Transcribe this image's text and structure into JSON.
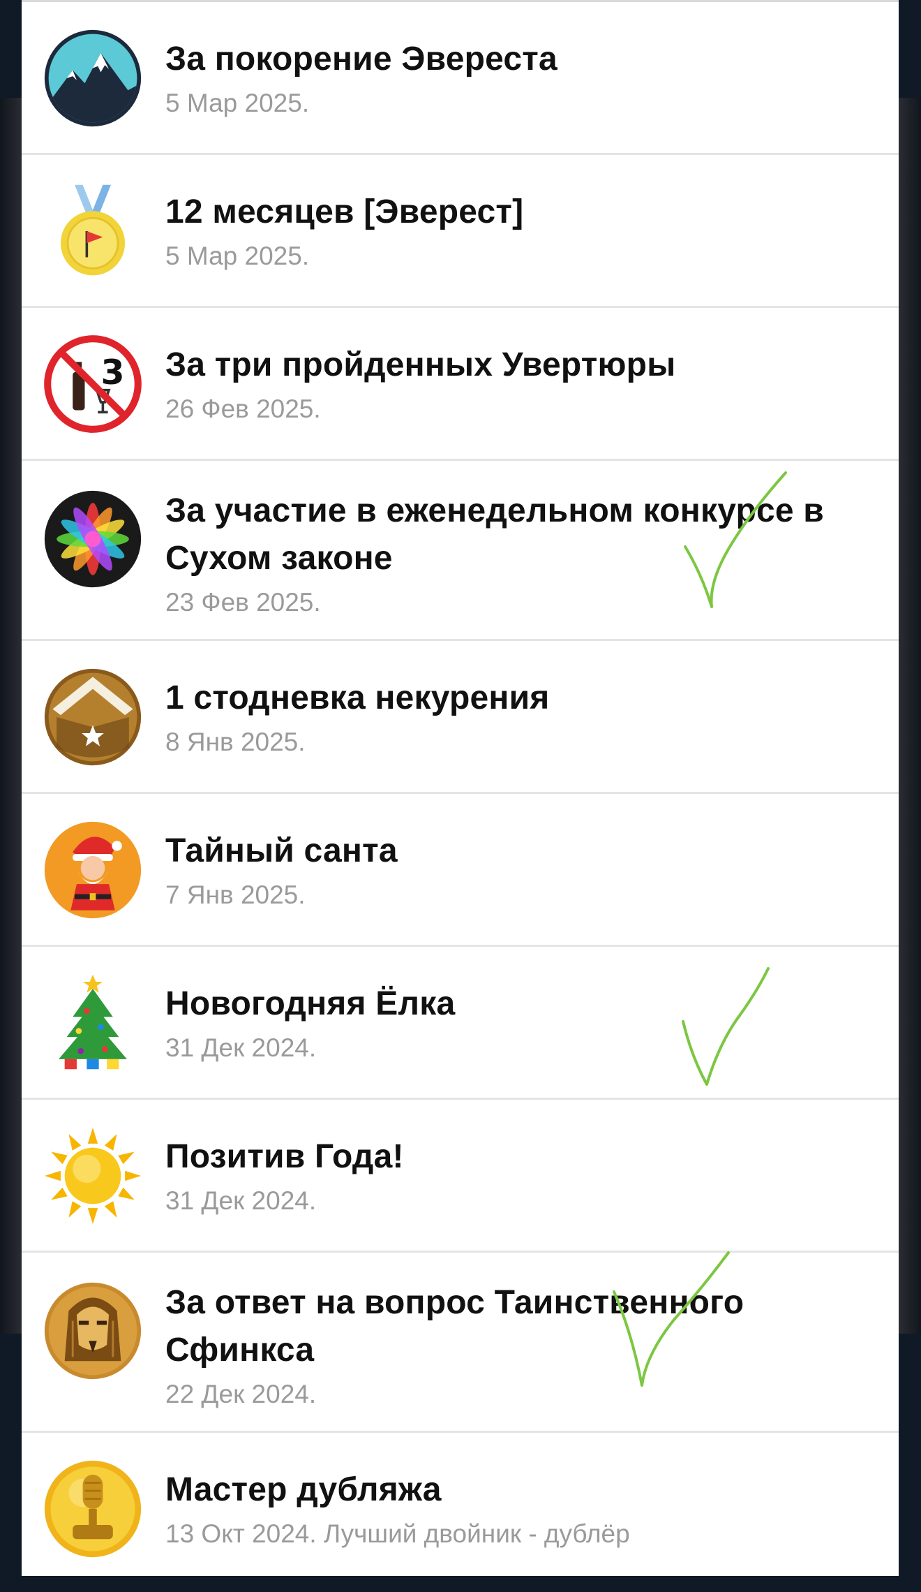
{
  "awards": [
    {
      "title": "За покорение Эвереста",
      "date": "5 Мар 2025.",
      "icon": "mountain-icon"
    },
    {
      "title": "12 месяцев [Эверест]",
      "date": "5 Мар 2025.",
      "icon": "medal-icon"
    },
    {
      "title": "За три пройденных Увертюры",
      "date": "26 Фев 2025.",
      "icon": "no-alcohol-icon"
    },
    {
      "title": "За участие в еженедельном конкурсе в Сухом законе",
      "date": "23 Фев 2025.",
      "icon": "rainbow-wheel-icon"
    },
    {
      "title": "1 стодневка некурения",
      "date": "8 Янв 2025.",
      "icon": "gold-badge-icon"
    },
    {
      "title": "Тайный санта",
      "date": "7 Янв 2025.",
      "icon": "santa-icon"
    },
    {
      "title": "Новогодняя Ёлка",
      "date": "31 Дек 2024.",
      "icon": "christmas-tree-icon"
    },
    {
      "title": "Позитив Года!",
      "date": "31 Дек 2024.",
      "icon": "sun-icon"
    },
    {
      "title": "За ответ на вопрос Таинственного Сфинкса",
      "date": "22 Дек 2024.",
      "icon": "sphinx-icon"
    },
    {
      "title": "Мастер дубляжа",
      "date": "13 Окт 2024. Лучший двойник - дублёр",
      "icon": "microphone-award-icon"
    }
  ],
  "checkmark_color": "#7cc742"
}
